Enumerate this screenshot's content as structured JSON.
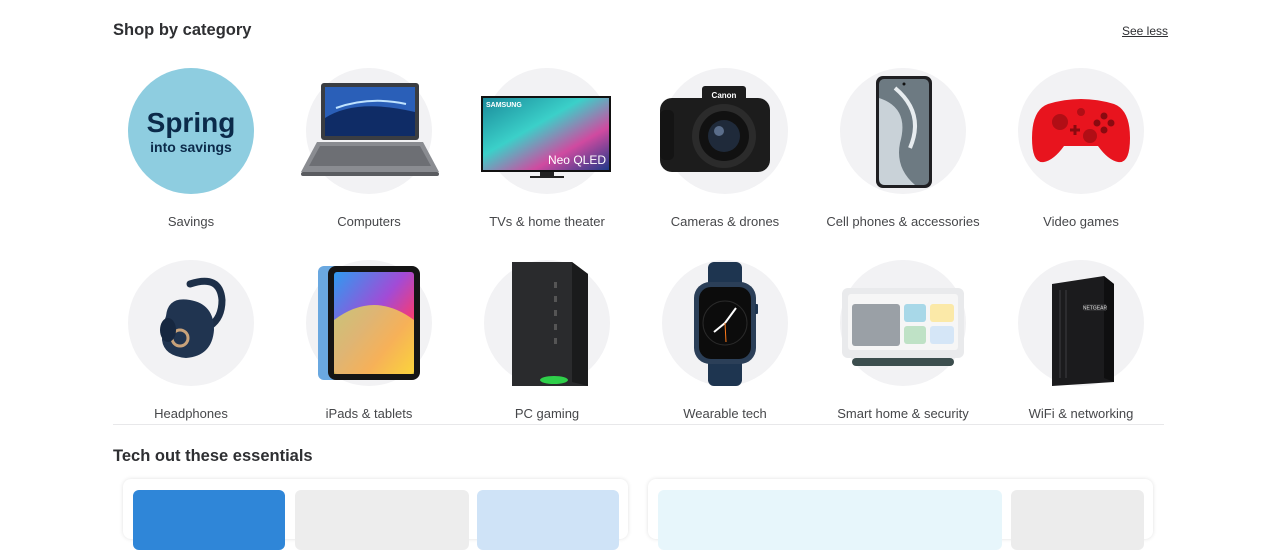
{
  "category_section": {
    "title": "Shop by category",
    "see_less_label": "See less",
    "items": [
      {
        "label": "Savings",
        "icon": "spring-savings-badge",
        "badge_line1": "Spring",
        "badge_line2": "into savings"
      },
      {
        "label": "Computers",
        "icon": "laptop-icon"
      },
      {
        "label": "TVs & home theater",
        "icon": "tv-icon",
        "brand": "SAMSUNG",
        "screen_text": "Neo QLED"
      },
      {
        "label": "Cameras & drones",
        "icon": "camera-icon",
        "brand": "Canon"
      },
      {
        "label": "Cell phones & accessories",
        "icon": "phone-icon"
      },
      {
        "label": "Video games",
        "icon": "game-controller-icon"
      },
      {
        "label": "Headphones",
        "icon": "earbud-icon"
      },
      {
        "label": "iPads & tablets",
        "icon": "tablet-icon"
      },
      {
        "label": "PC gaming",
        "icon": "gaming-pc-icon"
      },
      {
        "label": "Wearable tech",
        "icon": "smartwatch-icon"
      },
      {
        "label": "Smart home & security",
        "icon": "smart-display-icon"
      },
      {
        "label": "WiFi & networking",
        "icon": "router-icon",
        "brand": "NETGEAR"
      }
    ]
  },
  "tech_section": {
    "title": "Tech out these essentials"
  },
  "colors": {
    "savings_circle": "#8ecde0",
    "savings_text": "#0b2a4a",
    "circle_bg": "#f2f2f4",
    "controller_red": "#e8141e"
  }
}
